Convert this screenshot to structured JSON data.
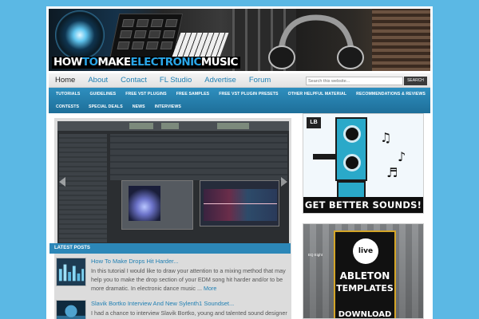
{
  "site": {
    "logo_parts": [
      "HOW",
      "TO",
      "MAKE",
      "ELECTRONIC",
      "MUSIC"
    ]
  },
  "nav": {
    "items": [
      "Home",
      "About",
      "Contact",
      "FL Studio",
      "Advertise",
      "Forum"
    ],
    "search_placeholder": "Search this website...",
    "search_button": "SEARCH"
  },
  "categories": {
    "row1": [
      "TUTORIALS",
      "GUIDELINES",
      "FREE VST PLUGINS",
      "FREE SAMPLES",
      "FREE VST PLUGIN PRESETS",
      "OTHER HELPFUL MATERIAL",
      "RECOMMENDATIONS & REVIEWS"
    ],
    "row2": [
      "CONTESTS",
      "SPECIAL DEALS",
      "NEWS",
      "INTERVIEWS"
    ]
  },
  "latest": {
    "heading": "LATEST POSTS",
    "posts": [
      {
        "title": "How To Make Drops Hit Harder...",
        "body": "In this tutorial I would like to draw your attention to a mixing method that may help you to make the drop section of your EDM song hit harder and/or to be more dramatic. In electronic dance music ... ",
        "more": "More"
      },
      {
        "title": "Slavik Bortko Interview And New Sylenth1 Soundset...",
        "body": "I had a chance to interview Slavik Bortko, young and talented sound designer who has been creating patches for such well known synths as Native"
      }
    ]
  },
  "ads": {
    "sounds": {
      "badge": "LB",
      "cta": "GET BETTER SOUNDS!"
    },
    "ableton": {
      "eq_label": "EQ Eight",
      "badge": "live",
      "line1": "ABLETON",
      "line2": "TEMPLATES",
      "line3": "DOWNLOAD NOW"
    }
  },
  "colors": {
    "background": "#5bb8e4",
    "accent": "#2c87b8",
    "link": "#1f7fb3",
    "logo_highlight": "#2aa6e8"
  }
}
